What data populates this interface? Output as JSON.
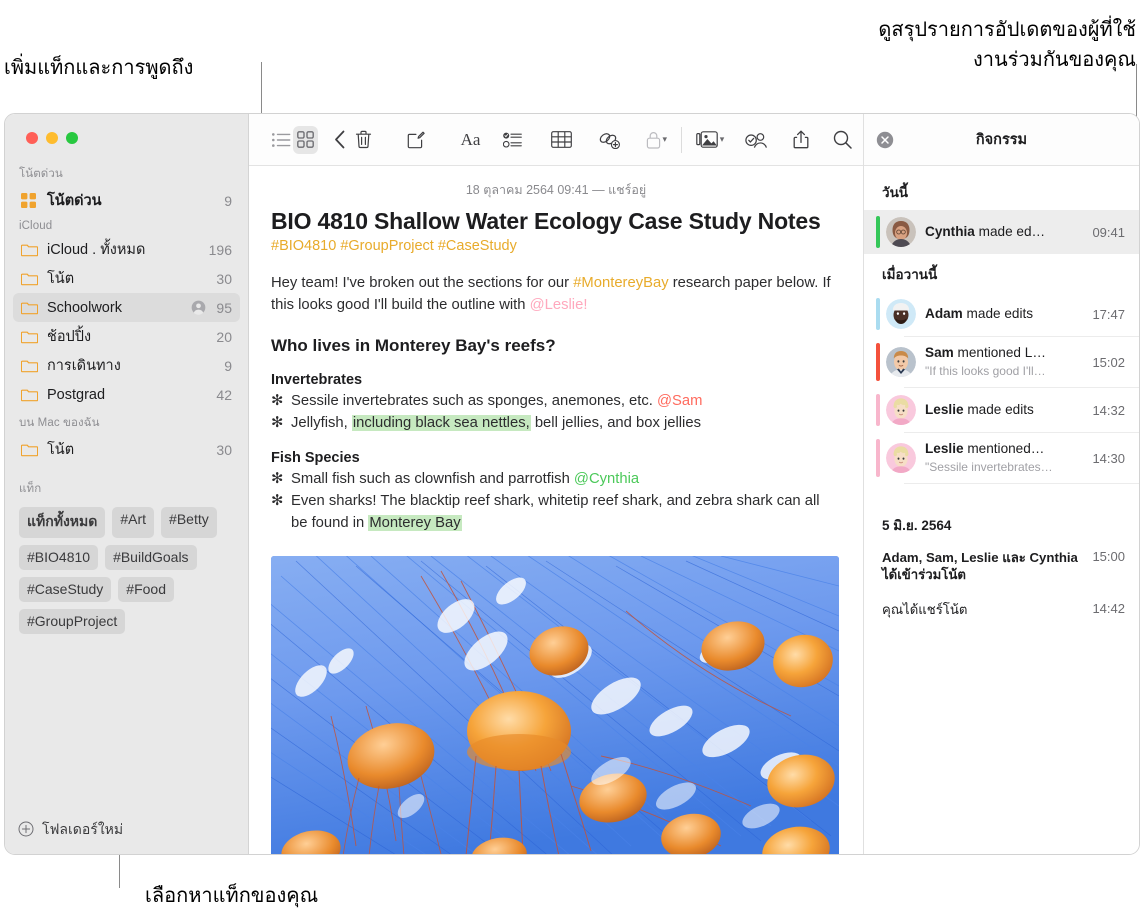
{
  "annotations": {
    "top_left": "เพิ่มแท็กและการพูดถึง",
    "top_right": "ดูสรุปรายการอัปเดตของผู้ที่ใช้\nงานร่วมกันของคุณ",
    "bottom": "เลือกหาแท็กของคุณ"
  },
  "sidebar": {
    "sections": [
      {
        "title": "โน้ตด่วน",
        "rows": [
          {
            "label": "โน้ตด่วน",
            "count": "9",
            "icon": "quicknote-icon",
            "bold": true,
            "selected": false,
            "shared": false
          }
        ]
      },
      {
        "title": "iCloud",
        "rows": [
          {
            "label": "iCloud . ทั้งหมด",
            "count": "196",
            "icon": "folder-icon",
            "bold": false,
            "selected": false,
            "shared": false
          },
          {
            "label": "โน้ต",
            "count": "30",
            "icon": "folder-icon",
            "bold": false,
            "selected": false,
            "shared": false
          },
          {
            "label": "Schoolwork",
            "count": "95",
            "icon": "folder-icon",
            "bold": false,
            "selected": true,
            "shared": true
          },
          {
            "label": "ช้อปปิ้ง",
            "count": "20",
            "icon": "folder-icon",
            "bold": false,
            "selected": false,
            "shared": false
          },
          {
            "label": "การเดินทาง",
            "count": "9",
            "icon": "folder-icon",
            "bold": false,
            "selected": false,
            "shared": false
          },
          {
            "label": "Postgrad",
            "count": "42",
            "icon": "folder-icon",
            "bold": false,
            "selected": false,
            "shared": false
          }
        ]
      },
      {
        "title": "บน Mac ของฉัน",
        "rows": [
          {
            "label": "โน้ต",
            "count": "30",
            "icon": "folder-icon",
            "bold": false,
            "selected": false,
            "shared": false
          }
        ]
      }
    ],
    "tags_title": "แท็ก",
    "tags": [
      {
        "label": "แท็กทั้งหมด",
        "bold": true
      },
      {
        "label": "#Art",
        "bold": false
      },
      {
        "label": "#Betty",
        "bold": false
      },
      {
        "label": "#BIO4810",
        "bold": false
      },
      {
        "label": "#BuildGoals",
        "bold": false
      },
      {
        "label": "#CaseStudy",
        "bold": false
      },
      {
        "label": "#Food",
        "bold": false
      },
      {
        "label": "#GroupProject",
        "bold": false
      }
    ],
    "new_folder_label": "โฟลเดอร์ใหม่"
  },
  "toolbar": {
    "items": [
      {
        "name": "list-view-icon",
        "active": false
      },
      {
        "name": "gallery-view-icon",
        "active": true
      },
      {
        "name": "back-chevron-icon",
        "active": false
      },
      {
        "name": "trash-icon",
        "active": false
      },
      {
        "name": "compose-icon",
        "active": false
      },
      {
        "name": "format-aa-icon",
        "active": false
      },
      {
        "name": "checklist-icon",
        "active": false
      },
      {
        "name": "table-icon",
        "active": false
      },
      {
        "name": "link-add-icon",
        "active": false
      },
      {
        "name": "lock-icon",
        "active": false
      },
      {
        "name": "media-icon",
        "active": false
      },
      {
        "name": "collaborate-icon",
        "active": false
      },
      {
        "name": "share-icon",
        "active": false
      },
      {
        "name": "search-icon",
        "active": false
      }
    ]
  },
  "note": {
    "date_line": "18 ตุลาคม 2564 09:41 — แชร์อยู่",
    "title": "BIO 4810 Shallow Water Ecology Case Study Notes",
    "tag_line": "#BIO4810 #GroupProject #CaseStudy",
    "intro": {
      "part1": "Hey team! I've broken out the sections for our ",
      "tag": "#MontereyBay",
      "part2": " research paper below. If this looks good I'll build the outline with ",
      "mention": "@Leslie!"
    },
    "heading": "Who lives in Monterey Bay's reefs?",
    "sections": [
      {
        "subheading": "Invertebrates",
        "bullets": [
          {
            "pre": "Sessile invertebrates such as sponges, anemones, etc. ",
            "highlight": "",
            "mid": "",
            "mention": "@Sam",
            "mention_color": "red",
            "post": ""
          },
          {
            "pre": "Jellyfish, ",
            "highlight": "including black sea nettles,",
            "mid": " bell jellies, and box jellies",
            "mention": "",
            "mention_color": "",
            "post": ""
          }
        ]
      },
      {
        "subheading": "Fish Species",
        "bullets": [
          {
            "pre": "Small fish such as clownfish and parrotfish ",
            "highlight": "",
            "mid": "",
            "mention": "@Cynthia",
            "mention_color": "green",
            "post": ""
          },
          {
            "pre": "Even sharks! The blacktip reef shark, whitetip reef shark, and zebra shark can all be found in ",
            "highlight": "Monterey Bay",
            "mid": "",
            "mention": "",
            "mention_color": "",
            "post": ""
          }
        ]
      }
    ],
    "photo_alt": "jellyfish-photo"
  },
  "activity": {
    "title": "กิจกรรม",
    "close_label": "ปิด",
    "groups": [
      {
        "title": "วันนี้",
        "items": [
          {
            "name": "Cynthia",
            "action": " made ed…",
            "quote": "",
            "time": "09:41",
            "bar_color": "#35c759",
            "selected": true,
            "avatar": "cynthia-avatar"
          }
        ]
      },
      {
        "title": "เมื่อวานนี้",
        "items": [
          {
            "name": "Adam",
            "action": " made edits",
            "quote": "",
            "time": "17:47",
            "bar_color": "#aadcf0",
            "selected": false,
            "avatar": "adam-avatar"
          },
          {
            "name": "Sam",
            "action": " mentioned L…",
            "quote": "\"If this looks good I'll…",
            "time": "15:02",
            "bar_color": "#f4513c",
            "selected": false,
            "avatar": "sam-avatar"
          },
          {
            "name": "Leslie",
            "action": " made edits",
            "quote": "",
            "time": "14:32",
            "bar_color": "#f8b6cc",
            "selected": false,
            "avatar": "leslie-avatar"
          },
          {
            "name": "Leslie",
            "action": " mentioned…",
            "quote": "\"Sessile invertebrates…",
            "time": "14:30",
            "bar_color": "#f8b6cc",
            "selected": false,
            "avatar": "leslie-avatar"
          }
        ]
      }
    ],
    "past_group": {
      "title": "5 มิ.ย. 2564",
      "rows": [
        {
          "text": "Adam, Sam, Leslie และ Cynthia ได้เข้าร่วมโน้ต",
          "time": "15:00",
          "bold": true
        },
        {
          "text": "คุณได้แชร์โน้ต",
          "time": "14:42",
          "bold": false
        }
      ]
    }
  },
  "colors": {
    "tag_yellow": "#e8ab2b",
    "highlight_green": "#c6e9c0",
    "mention_red": "#ff6b5e",
    "mention_green": "#4cc95a",
    "mention_pink": "#ffa8bd",
    "folder_orange": "#f0a32e",
    "sidebar_bg": "#e9e9e9"
  }
}
